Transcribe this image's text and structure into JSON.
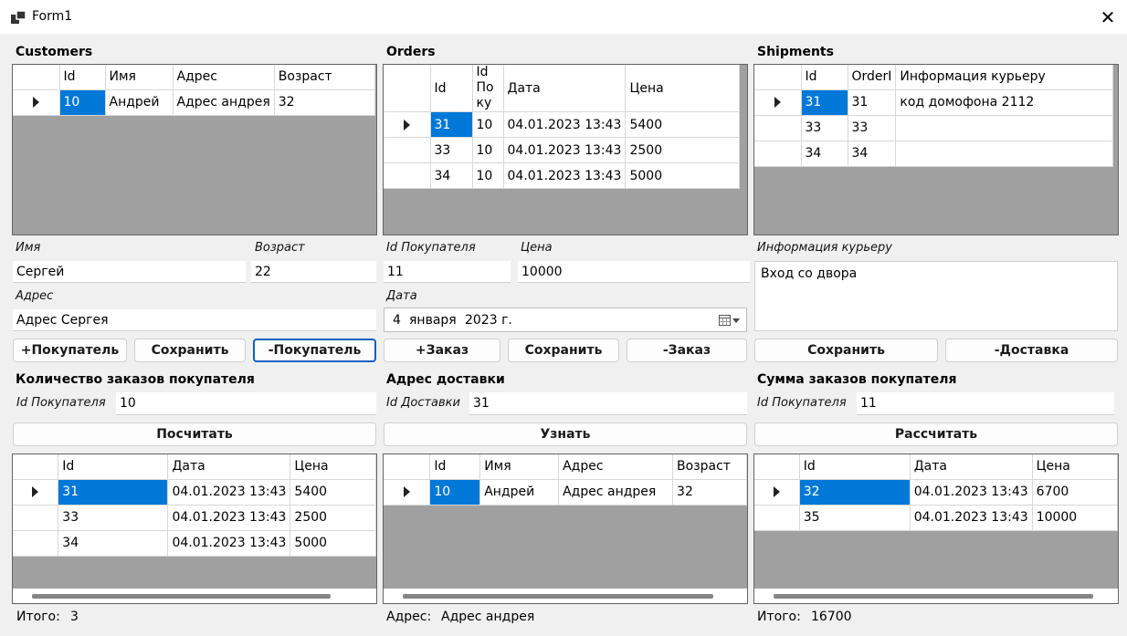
{
  "window": {
    "title": "Form1",
    "close_glyph": "✕",
    "icon": "app-icon"
  },
  "customers": {
    "title": "Customers",
    "columns": [
      "Id",
      "Имя",
      "Адрес",
      "Возраст"
    ],
    "rows": [
      [
        "10",
        "Андрей",
        "Адрес андрея",
        "32"
      ]
    ]
  },
  "orders": {
    "title": "Orders",
    "columns": [
      "Id",
      "Id Поку",
      "Дата",
      "Цена"
    ],
    "rows": [
      [
        "31",
        "10",
        "04.01.2023 13:43",
        "5400"
      ],
      [
        "33",
        "10",
        "04.01.2023 13:43",
        "2500"
      ],
      [
        "34",
        "10",
        "04.01.2023 13:43",
        "5000"
      ]
    ]
  },
  "shipments": {
    "title": "Shipments",
    "columns": [
      "Id",
      "OrderI",
      "Информация курьеру"
    ],
    "rows": [
      [
        "31",
        "31",
        "код домофона 2112"
      ],
      [
        "33",
        "33",
        ""
      ],
      [
        "34",
        "34",
        ""
      ]
    ]
  },
  "customer_form": {
    "name_label": "Имя",
    "name_value": "Сергей",
    "age_label": "Возраст",
    "age_value": "22",
    "address_label": "Адрес",
    "address_value": "Адрес Сергея",
    "add_button": "+Покупатель",
    "save_button": "Сохранить",
    "remove_button": "-Покупатель"
  },
  "order_form": {
    "buyer_id_label": "Id Покупателя",
    "buyer_id_value": "11",
    "price_label": "Цена",
    "price_value": "10000",
    "date_label": "Дата",
    "date_day": "4",
    "date_month": "января",
    "date_year": "2023 г.",
    "add_button": "+Заказ",
    "save_button": "Сохранить",
    "remove_button": "-Заказ"
  },
  "shipment_form": {
    "info_label": "Информация курьеру",
    "info_value": "Вход со двора",
    "save_button": "Сохранить",
    "remove_button": "-Доставка"
  },
  "order_count": {
    "title": "Количество заказов покупателя",
    "id_label": "Id Покупателя",
    "id_value": "10",
    "button": "Посчитать",
    "columns": [
      "Id",
      "Дата",
      "Цена"
    ],
    "rows": [
      [
        "31",
        "04.01.2023 13:43",
        "5400"
      ],
      [
        "33",
        "04.01.2023 13:43",
        "2500"
      ],
      [
        "34",
        "04.01.2023 13:43",
        "5000"
      ]
    ],
    "total_label": "Итого:",
    "total_value": "3"
  },
  "delivery_address": {
    "title": "Адрес доставки",
    "id_label": "Id Доставки",
    "id_value": "31",
    "button": "Узнать",
    "columns": [
      "Id",
      "Имя",
      "Адрес",
      "Возраст"
    ],
    "rows": [
      [
        "10",
        "Андрей",
        "Адрес андрея",
        "32"
      ]
    ],
    "result_label": "Адрес:",
    "result_value": "Адрес андрея"
  },
  "order_sum": {
    "title": "Сумма заказов покупателя",
    "id_label": "Id Покупателя",
    "id_value": "11",
    "button": "Рассчитать",
    "columns": [
      "Id",
      "Дата",
      "Цена"
    ],
    "rows": [
      [
        "32",
        "04.01.2023 13:43",
        "6700"
      ],
      [
        "35",
        "04.01.2023 13:43",
        "10000"
      ]
    ],
    "total_label": "Итого:",
    "total_value": "16700"
  },
  "colors": {
    "selection": "#0078d7",
    "grid_background": "#a0a0a0",
    "focus_border": "#0f5fbf"
  }
}
